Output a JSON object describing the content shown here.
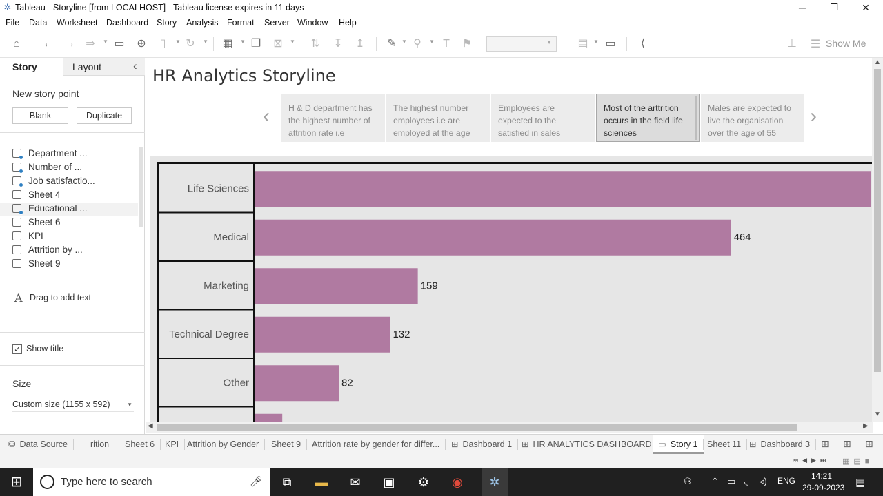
{
  "window": {
    "title": "Tableau - Storyline [from LOCALHOST] - Tableau license expires in 11 days",
    "minimize": "─",
    "restore": "❐",
    "close": "✕"
  },
  "menu": [
    "File",
    "Data",
    "Worksheet",
    "Dashboard",
    "Story",
    "Analysis",
    "Format",
    "Server",
    "Window",
    "Help"
  ],
  "toolbar": {
    "show_me": "Show Me"
  },
  "left_panel": {
    "tabs": [
      "Story",
      "Layout"
    ],
    "collapse": "‹",
    "new_story_point": "New story point",
    "blank_button": "Blank",
    "duplicate_button": "Duplicate",
    "sheets": [
      {
        "label": "Department ...",
        "dashboard": true
      },
      {
        "label": "Number of ...",
        "dashboard": true
      },
      {
        "label": "Job satisfactio...",
        "dashboard": true
      },
      {
        "label": "Sheet 4",
        "dashboard": false
      },
      {
        "label": "Educational ...",
        "dashboard": true
      },
      {
        "label": "Sheet 6",
        "dashboard": false
      },
      {
        "label": "KPI",
        "dashboard": false
      },
      {
        "label": "Attrition by ...",
        "dashboard": false
      },
      {
        "label": "Sheet 9",
        "dashboard": false
      }
    ],
    "drag_text": "Drag to add text",
    "drag_icon": "A",
    "show_title": "Show title",
    "show_title_checked": true,
    "size_heading": "Size",
    "size_value": "Custom size (1155 x 592)"
  },
  "story": {
    "title": "HR Analytics Storyline",
    "points": [
      {
        "text": "H & D department has the highest number of attrition rate i.e",
        "active": false
      },
      {
        "text": "The highest number employees i.e are employed at the age",
        "active": false
      },
      {
        "text": "Employees are expected to the satisfied in sales",
        "active": false
      },
      {
        "text": "Most of the arttrition occurs in the field life sciences",
        "active": true
      },
      {
        "text": "Males are expected to live the organisation over the age of 55",
        "active": false
      }
    ]
  },
  "chart_data": {
    "type": "bar",
    "orientation": "horizontal",
    "categories": [
      "Life Sciences",
      "Medical",
      "Marketing",
      "Technical Degree",
      "Other",
      ""
    ],
    "values": [
      606,
      464,
      159,
      132,
      82,
      27
    ],
    "data_labels": [
      "",
      "464",
      "159",
      "132",
      "82",
      ""
    ],
    "bar_color": "#b07aa1",
    "xlim": [
      0,
      600
    ]
  },
  "bottom_tabs": [
    {
      "label": "Data Source",
      "icon": "datasource-icon",
      "active": false
    },
    {
      "label": "rition",
      "icon": "",
      "active": false
    },
    {
      "label": "Sheet 6",
      "icon": "",
      "active": false
    },
    {
      "label": "KPI",
      "icon": "",
      "active": false
    },
    {
      "label": "Attrition by Gender",
      "icon": "",
      "active": false
    },
    {
      "label": "Sheet 9",
      "icon": "",
      "active": false
    },
    {
      "label": "Attrition rate by gender for differ...",
      "icon": "",
      "active": false
    },
    {
      "label": "Dashboard 1",
      "icon": "dashboard-icon",
      "active": false
    },
    {
      "label": "HR ANALYTICS DASHBOARD",
      "icon": "dashboard-icon",
      "active": false
    },
    {
      "label": "Story 1",
      "icon": "story-icon",
      "active": true
    },
    {
      "label": "Sheet 11",
      "icon": "",
      "active": false
    },
    {
      "label": "Dashboard 3",
      "icon": "dashboard-icon",
      "active": false
    }
  ],
  "taskbar": {
    "search_placeholder": "Type here to search",
    "language": "ENG",
    "time": "14:21",
    "date": "29-09-2023"
  }
}
